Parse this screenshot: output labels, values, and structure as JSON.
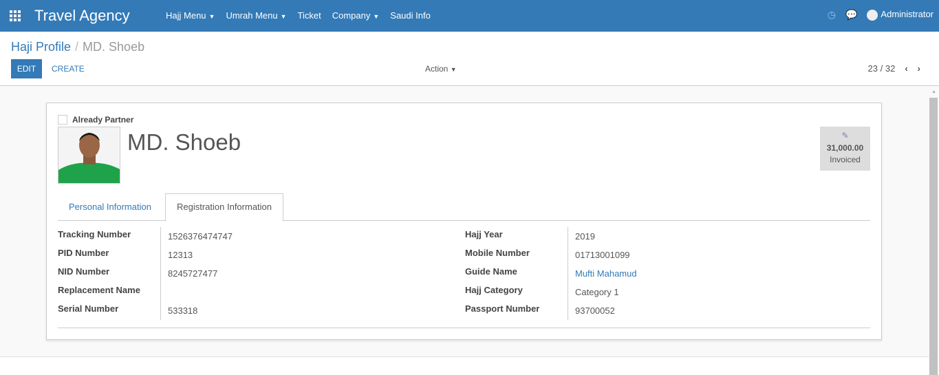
{
  "nav": {
    "brand": "Travel Agency",
    "menus": [
      {
        "label": "Hajj Menu",
        "dropdown": true
      },
      {
        "label": "Umrah Menu",
        "dropdown": true
      },
      {
        "label": "Ticket",
        "dropdown": false
      },
      {
        "label": "Company",
        "dropdown": true
      },
      {
        "label": "Saudi Info",
        "dropdown": false
      }
    ],
    "user": "Administrator",
    "icons": [
      "apps-grid-icon",
      "clock-icon",
      "chat-icon"
    ]
  },
  "breadcrumb": {
    "parent": "Haji Profile",
    "separator": "/",
    "current": "MD. Shoeb"
  },
  "toolbar": {
    "edit": "EDIT",
    "create": "CREATE",
    "action": "Action",
    "pager": "23 / 32"
  },
  "record": {
    "already_partner_label": "Already Partner",
    "already_partner": false,
    "name": "MD. Shoeb",
    "invoiced_amount": "31,000.00",
    "invoiced_label": "Invoiced"
  },
  "tabs": [
    {
      "label": "Personal Information",
      "active": false
    },
    {
      "label": "Registration Information",
      "active": true
    }
  ],
  "left_fields": [
    {
      "label": "Tracking Number",
      "value": "1526376474747"
    },
    {
      "label": "PID Number",
      "value": "12313"
    },
    {
      "label": "NID Number",
      "value": "8245727477"
    },
    {
      "label": "Replacement Name",
      "value": ""
    },
    {
      "label": "Serial Number",
      "value": "533318"
    }
  ],
  "right_fields": [
    {
      "label": "Hajj Year",
      "value": "2019"
    },
    {
      "label": "Mobile Number",
      "value": "01713001099"
    },
    {
      "label": "Guide Name",
      "value": "Mufti Mahamud",
      "link": true
    },
    {
      "label": "Hajj Category",
      "value": "Category 1"
    },
    {
      "label": "Passport Number",
      "value": "93700052"
    }
  ],
  "colors": {
    "primary": "#337ab7"
  }
}
